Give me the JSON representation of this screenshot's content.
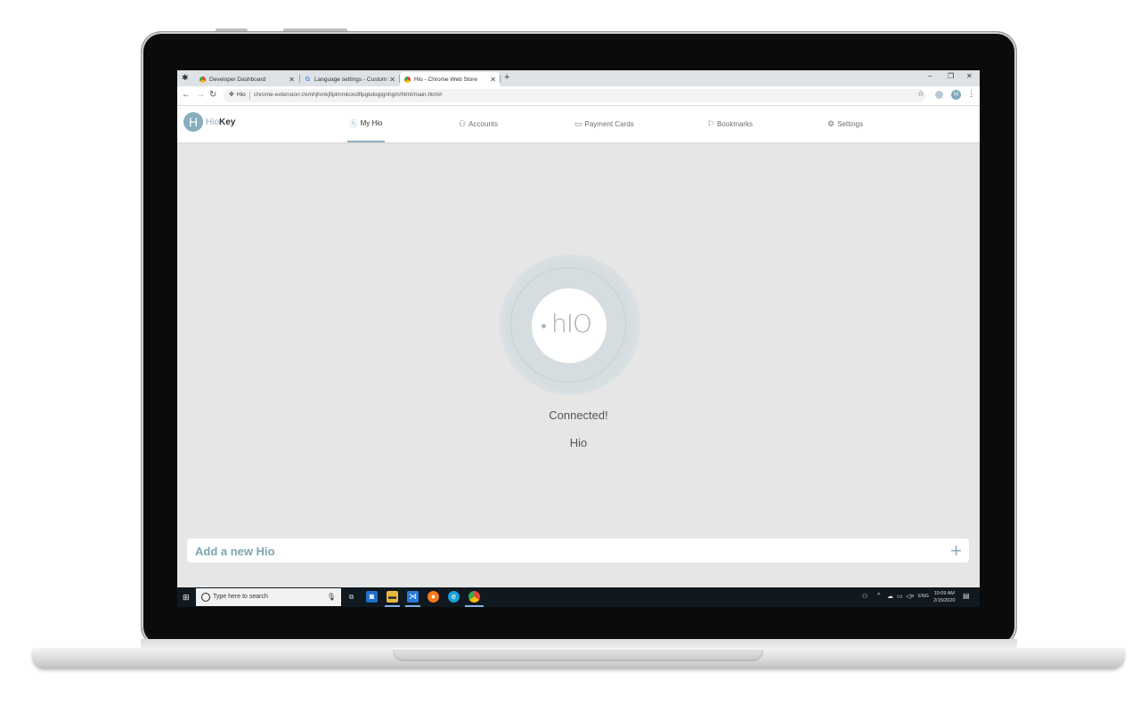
{
  "browser": {
    "tabs": [
      {
        "label": "Developer Dashboard",
        "favicon": "chrome-icon",
        "active": false
      },
      {
        "label": "Language settings - Custom Sea",
        "favicon": "google-icon",
        "active": false
      },
      {
        "label": "Hio - Chrome Web Store",
        "favicon": "chrome-icon",
        "active": true
      }
    ],
    "new_tab": "+",
    "window_controls": {
      "minimize": "–",
      "maximize": "❐",
      "close": "✕"
    },
    "omnibox": {
      "site_name": "Hio",
      "url": "chrome-extension://emhjhmkjfiplmmkocdflpgkdogignhgm/html/main.html#"
    }
  },
  "app": {
    "logo": {
      "mark": "H",
      "part1": "Hio",
      "part2": "Key"
    },
    "nav": [
      {
        "label": "My Hio",
        "icon": "hio-icon",
        "glyph": "ⓗ",
        "active": true
      },
      {
        "label": "Accounts",
        "icon": "user-icon",
        "glyph": "⚇",
        "active": false
      },
      {
        "label": "Payment Cards",
        "icon": "card-icon",
        "glyph": "▭",
        "active": false
      },
      {
        "label": "Bookmarks",
        "icon": "bookmark-icon",
        "glyph": "⚐",
        "active": false
      },
      {
        "label": "Settings",
        "icon": "gear-icon",
        "glyph": "⚙",
        "active": false
      }
    ],
    "device_logo": "hIO",
    "status": "Connected!",
    "device_name": "Hio",
    "add_label": "Add a new Hio",
    "add_icon": "+"
  },
  "taskbar": {
    "search_placeholder": "Type here to search",
    "language": "ENG",
    "time": "10:09 AM",
    "date": "2/15/2020"
  },
  "colors": {
    "accent": "#8fb0bf",
    "taskbar": "#101820",
    "background": "#e6e6e6"
  }
}
